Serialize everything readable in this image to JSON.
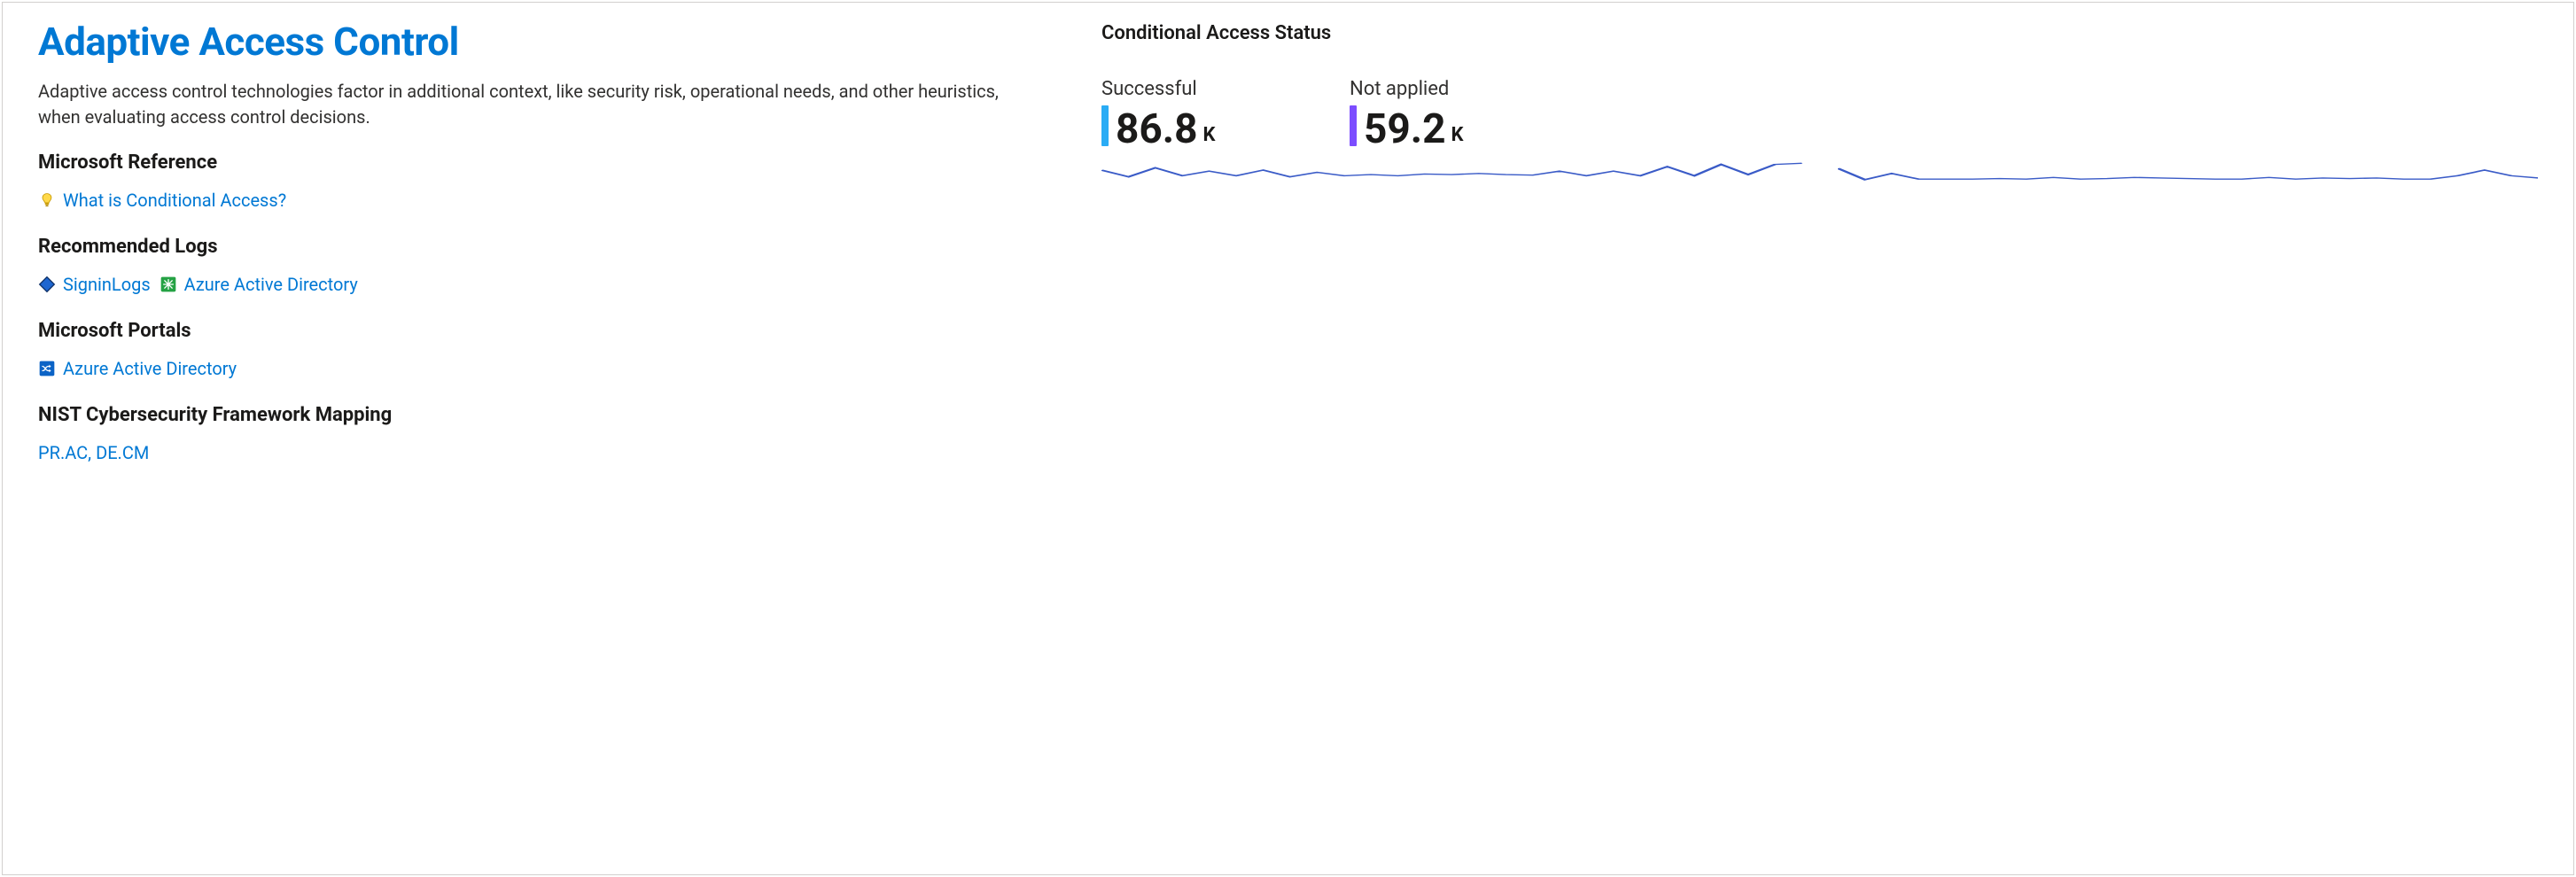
{
  "main": {
    "title": "Adaptive Access Control",
    "description": "Adaptive access control technologies factor in additional context, like security risk, operational needs, and other heuristics, when evaluating access control decisions."
  },
  "sections": {
    "reference": {
      "heading": "Microsoft Reference",
      "links": [
        {
          "label": "What is Conditional Access?",
          "icon": "lightbulb"
        }
      ]
    },
    "logs": {
      "heading": "Recommended Logs",
      "links": [
        {
          "label": "SigninLogs",
          "icon": "blue-diamond"
        },
        {
          "label": "Azure Active Directory",
          "icon": "green-star-square"
        }
      ]
    },
    "portals": {
      "heading": "Microsoft Portals",
      "links": [
        {
          "label": "Azure Active Directory",
          "icon": "shuffle-square"
        }
      ]
    },
    "nist": {
      "heading": "NIST Cybersecurity Framework Mapping",
      "mapping": "PR.AC, DE.CM"
    }
  },
  "status": {
    "title": "Conditional Access Status",
    "kpis": [
      {
        "label": "Successful",
        "value": "86.8",
        "unit": "K",
        "accent": "cyan"
      },
      {
        "label": "Not applied",
        "value": "59.2",
        "unit": "K",
        "accent": "purple"
      }
    ]
  },
  "chart_data": {
    "type": "line",
    "title": "Conditional Access Status",
    "series": [
      {
        "name": "Successful",
        "unit": "K",
        "total": 86.8,
        "values": [
          3.6,
          2.4,
          4.0,
          2.6,
          3.4,
          2.6,
          3.6,
          2.4,
          3.2,
          2.6,
          2.8,
          2.6,
          2.9,
          2.8,
          3.0,
          2.8,
          2.7,
          3.4,
          2.6,
          3.4,
          2.6,
          4.2,
          2.6,
          4.6,
          2.8,
          4.6,
          4.8
        ]
      },
      {
        "name": "Not applied",
        "unit": "K",
        "total": 59.2,
        "values": [
          3.9,
          1.9,
          3.0,
          2.0,
          2.0,
          2.0,
          2.1,
          2.0,
          2.3,
          2.0,
          2.1,
          2.3,
          2.2,
          2.1,
          2.0,
          2.0,
          2.3,
          2.0,
          2.2,
          2.1,
          2.2,
          2.0,
          2.0,
          2.6,
          3.6,
          2.6,
          2.2
        ]
      }
    ],
    "xlabel": "",
    "ylabel": "",
    "ylim": [
      0,
      5
    ]
  }
}
